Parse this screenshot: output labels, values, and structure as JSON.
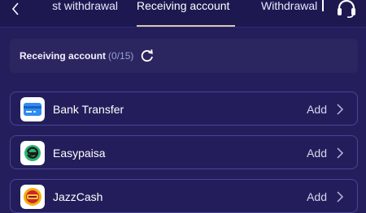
{
  "header": {
    "tabs": [
      {
        "label": "st withdrawal",
        "active": false
      },
      {
        "label": "Receiving account",
        "active": true
      },
      {
        "label": "Withdrawal",
        "active": false
      }
    ],
    "accent_color": "#d9c8a8",
    "back_icon": "chevron-left-icon",
    "support_icon": "headset-icon"
  },
  "account_panel": {
    "title": "Receiving account",
    "count": "(0/15)",
    "refresh_icon": "refresh-icon"
  },
  "methods": [
    {
      "name": "Bank Transfer",
      "action": "Add",
      "icon": "bank-card-icon"
    },
    {
      "name": "Easypaisa",
      "action": "Add",
      "icon": "easypaisa-logo-icon"
    },
    {
      "name": "JazzCash",
      "action": "Add",
      "icon": "jazzcash-logo-icon"
    }
  ]
}
